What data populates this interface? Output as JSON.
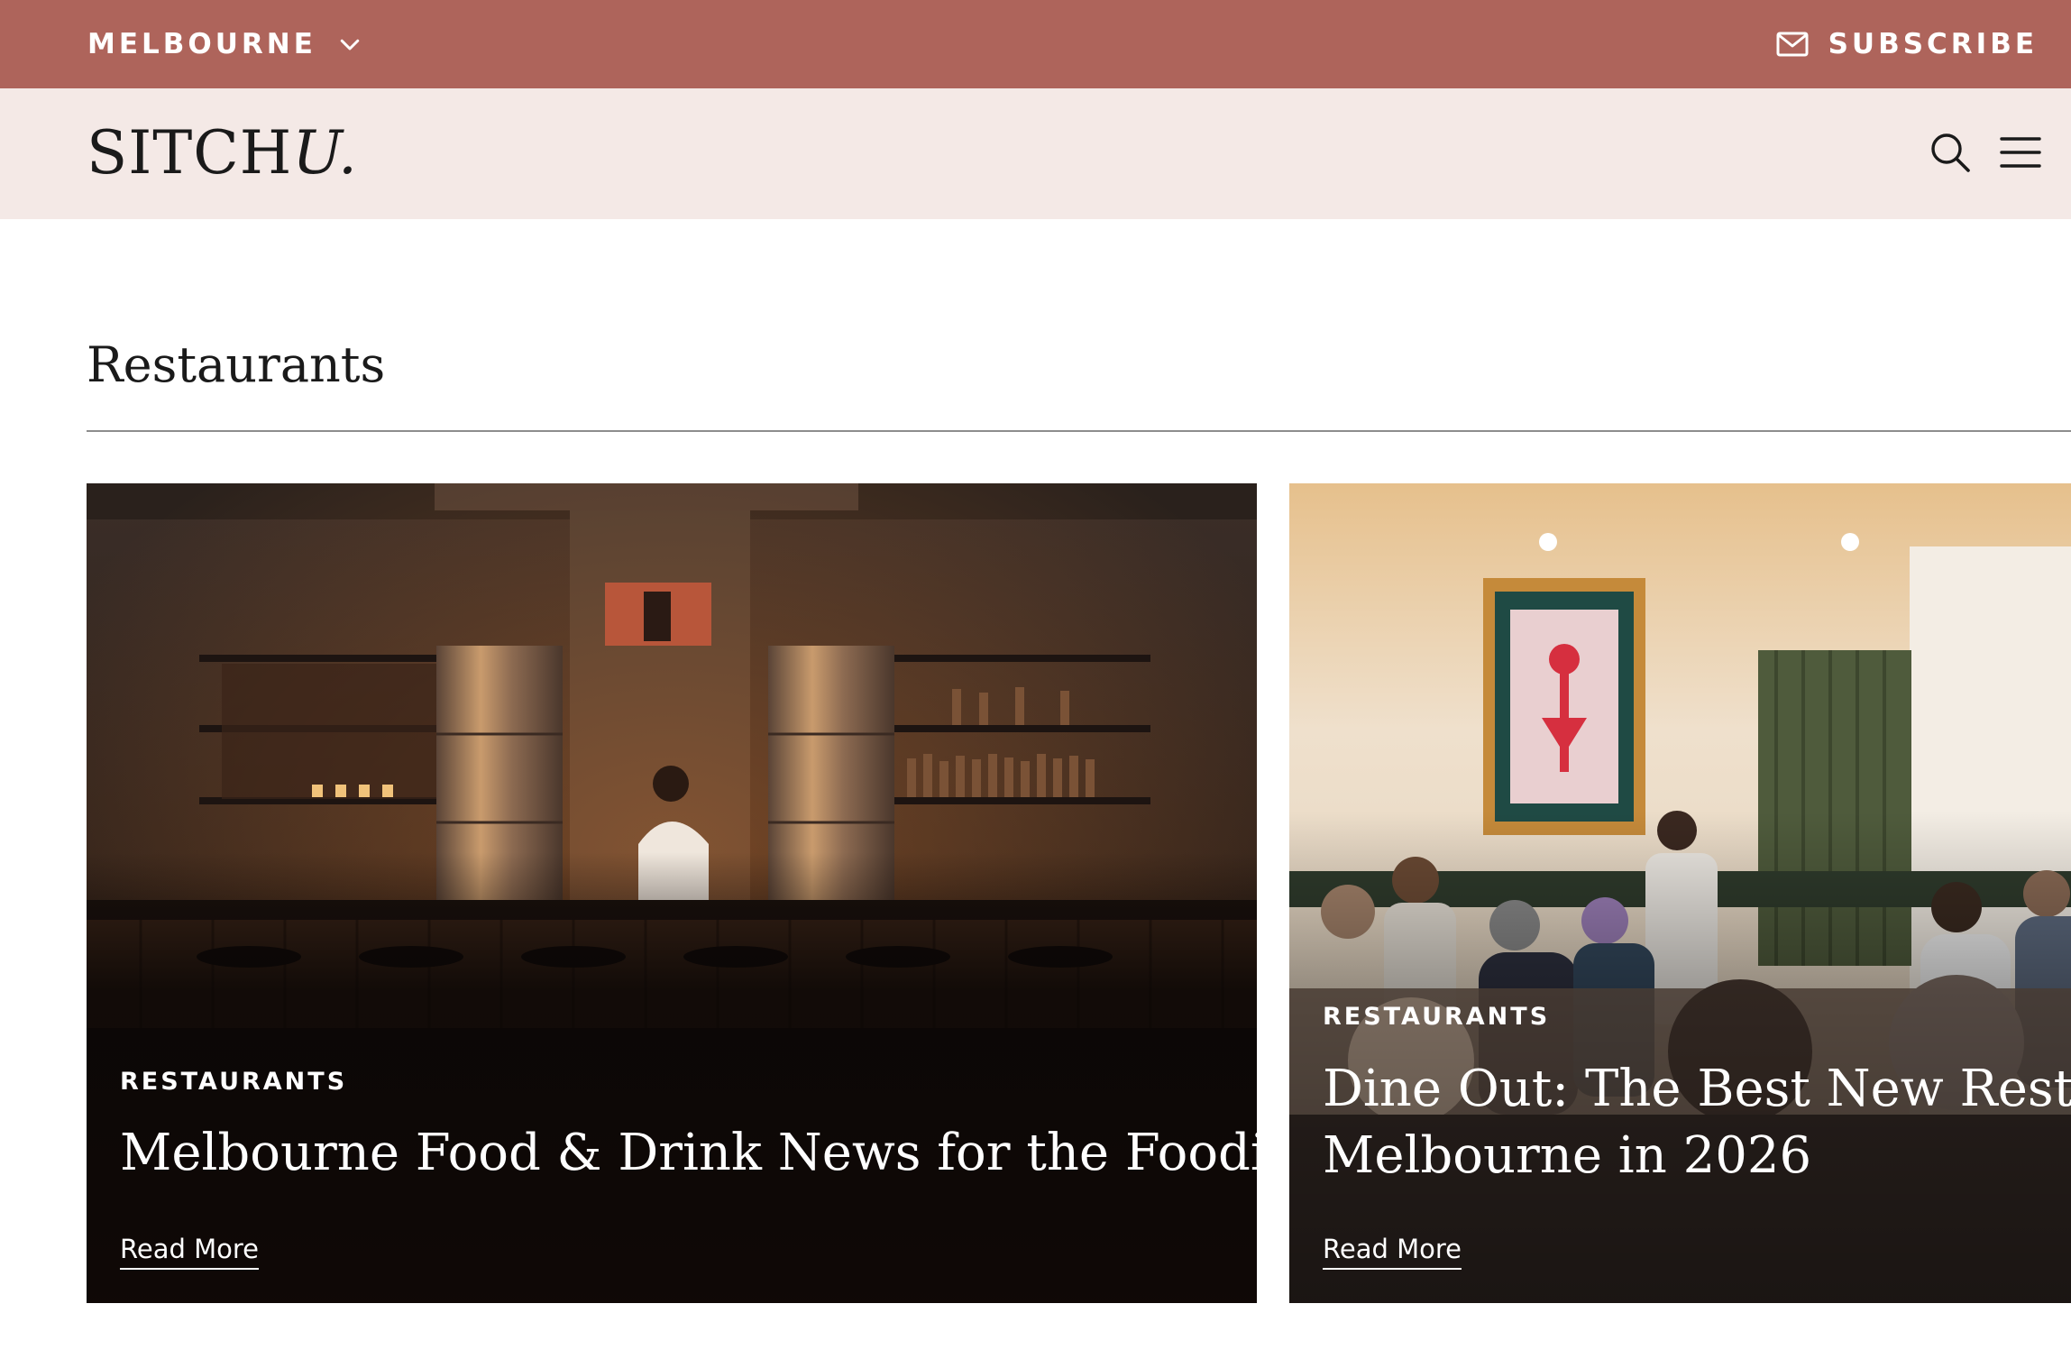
{
  "topbar": {
    "city": "MELBOURNE",
    "subscribe_label": "SUBSCRIBE",
    "background": "#ae645b"
  },
  "header": {
    "logo_text": "SITCH",
    "logo_italic": "U.",
    "background": "#f4e9e6"
  },
  "section": {
    "title": "Restaurants"
  },
  "cards": [
    {
      "category": "RESTAURANTS",
      "title": "Melbourne Food & Drink News for the Foodies",
      "link_label": "Read More"
    },
    {
      "category": "RESTAURANTS",
      "title_line1": "Dine Out: The Best New Restaurants",
      "title_line2": "Melbourne in 2026",
      "link_label": "Read More"
    }
  ],
  "icons": {
    "city_dropdown": "chevron-down-icon",
    "subscribe": "mail-icon",
    "search": "search-icon",
    "menu": "menu-icon"
  }
}
